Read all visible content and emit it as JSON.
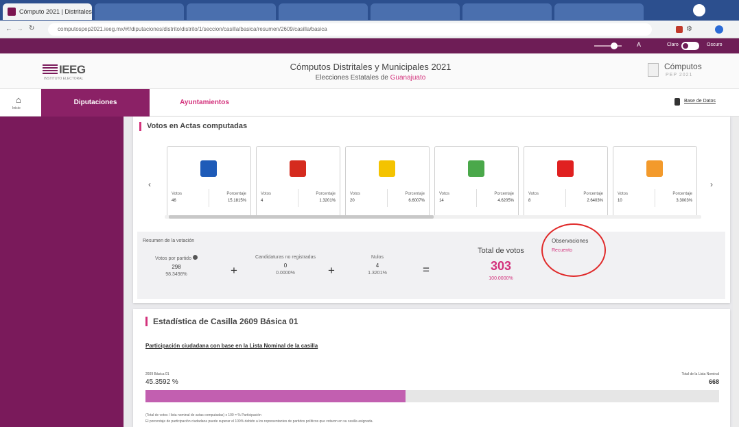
{
  "browser": {
    "tabs": [
      "Cómputo 2021 | Distritales",
      "",
      "",
      "",
      "",
      "",
      ""
    ],
    "url": "computospep2021.ieeg.mx/#!/diputaciones/distrito/distrito/1/seccion/casilla/basica/resumen/2609/casilla/basica"
  },
  "topbar": {
    "theme_label": "Claro",
    "theme_label2": "Oscuro"
  },
  "header": {
    "logo_text": "IEEG",
    "logo_sub": "INSTITUTO ELECTORAL",
    "title": "Cómputos Distritales y Municipales 2021",
    "subtitle_prefix": "Elecciones Estatales de ",
    "subtitle_state": "Guanajuato",
    "badge_title": "Cómputos",
    "badge_sub": "PEP 2021"
  },
  "nav": {
    "home_label": "Inicio",
    "tabs": [
      "Diputaciones",
      "Ayuntamientos"
    ],
    "data_base": "Base de Datos"
  },
  "votes_section": {
    "title": "Votos en Actas computadas",
    "parties": [
      {
        "icon": "pan-logo",
        "color": "#1e5bb8",
        "votos_label": "Votos",
        "votos": "46",
        "pct_label": "Porcentaje",
        "pct": "15.1815%"
      },
      {
        "icon": "pri-logo",
        "color": "#d52b1e",
        "votos_label": "Votos",
        "votos": "4",
        "pct_label": "Porcentaje",
        "pct": "1.3201%"
      },
      {
        "icon": "prd-logo",
        "color": "#f4c300",
        "votos_label": "Votos",
        "votos": "20",
        "pct_label": "Porcentaje",
        "pct": "6.6007%"
      },
      {
        "icon": "pvem-logo",
        "color": "#4aa84a",
        "votos_label": "Votos",
        "votos": "14",
        "pct_label": "Porcentaje",
        "pct": "4.6205%"
      },
      {
        "icon": "pt-logo",
        "color": "#e02020",
        "votos_label": "Votos",
        "votos": "8",
        "pct_label": "Porcentaje",
        "pct": "2.6403%"
      },
      {
        "icon": "mc-logo",
        "color": "#f39a2b",
        "votos_label": "Votos",
        "votos": "10",
        "pct_label": "Porcentaje",
        "pct": "3.3003%"
      }
    ]
  },
  "summary": {
    "title": "Resumen de la votación",
    "partidos_label": "Votos por partido",
    "partidos_value": "298",
    "partidos_pct": "98.3498%",
    "no_reg_label": "Candidaturas no registradas",
    "no_reg_value": "0",
    "no_reg_pct": "0.0000%",
    "nulos_label": "Nulos",
    "nulos_value": "4",
    "nulos_pct": "1.3201%",
    "plus": "+",
    "equals": "=",
    "total_label": "Total de votos",
    "total_value": "303",
    "total_pct": "100.0000%",
    "obs_label": "Observaciones",
    "obs_value": "Recuento",
    "accent": "#d3327c"
  },
  "stats": {
    "title": "Estadística de Casilla 2609 Básica 01",
    "link": "Participación ciudadana con base en la Lista Nominal de la casilla",
    "casilla_label": "2609 Básica 01",
    "percent": "45.3592 %",
    "participation": 45.3592,
    "lista_label": "Total de la Lista Nominal",
    "lista_value": "668",
    "note1": "(Total de votos / lista nominal de actas computadas) x 100 = % Participación",
    "note2": "El porcentaje de participación ciudadana puede superar el 100% debido a los representantes de partidos políticos que votaron en su casilla asignada."
  }
}
